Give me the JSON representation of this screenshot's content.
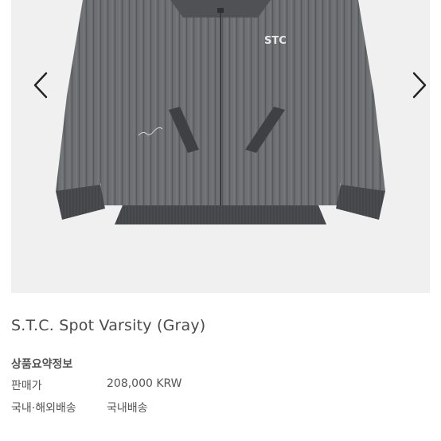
{
  "product": {
    "title": "S.T.C. Spot Varsity (Gray)",
    "image_alt": "gray quilted varsity jacket",
    "chest_logo": "STC",
    "colors": {
      "body": "#6e7073",
      "sleeve_dark": "#4b4c4f",
      "background": "#f0f0f0"
    }
  },
  "gallery": {
    "prev_icon": "chevron-left-icon",
    "next_icon": "chevron-right-icon"
  },
  "summary": {
    "heading": "상품요약정보",
    "rows": [
      {
        "label": "판매가",
        "value": "208,000 KRW"
      },
      {
        "label": "국내·해외배송",
        "value": "국내배송"
      }
    ]
  }
}
